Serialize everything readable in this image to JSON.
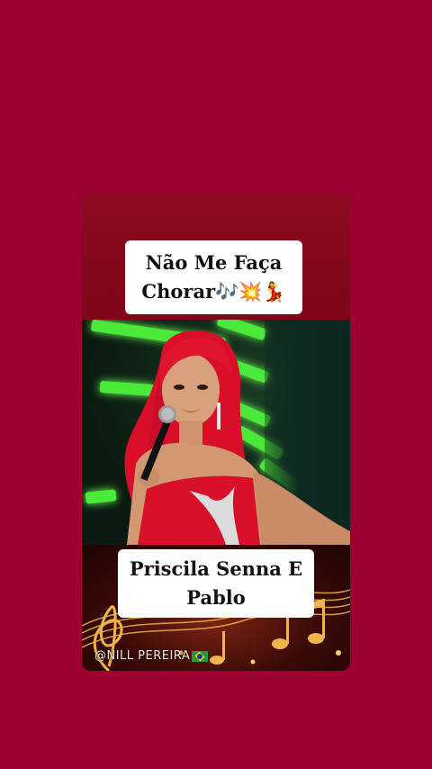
{
  "post": {
    "title": "Não Me Faça Chorar🎶💥💃",
    "caption": "Priscila Senna E Pablo",
    "watermark": "@NILL PEREIRA"
  },
  "colors": {
    "background": "#9c0030",
    "card_top": "#8d0b20",
    "stage_green": "#4bea3a",
    "dress_red": "#d8102a",
    "hair_red": "#e0102a",
    "label_box": "#ffffff",
    "notes_gold": "#f2b34a"
  },
  "icons": {
    "watermark_flag": "brazil-flag-icon",
    "decor": "music-notes-icon"
  }
}
